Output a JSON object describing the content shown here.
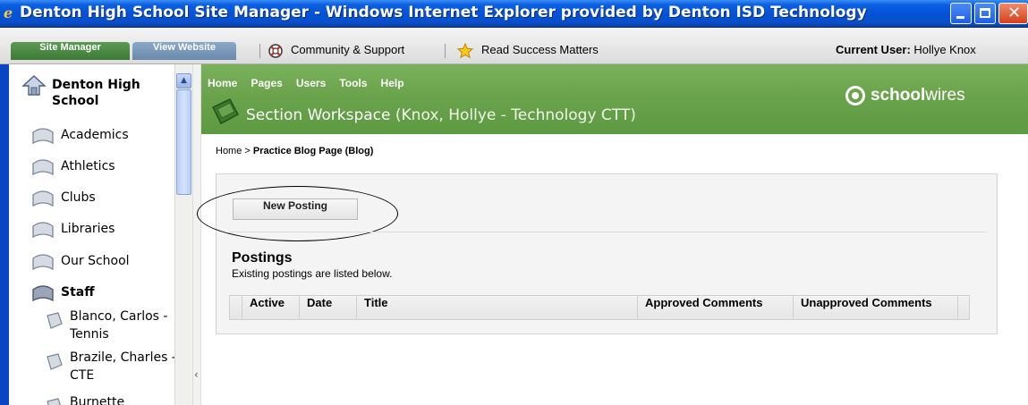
{
  "window": {
    "title": "Denton High School Site Manager - Windows Internet Explorer provided by Denton ISD Technology"
  },
  "toolbar": {
    "tabs": [
      {
        "label": "Site Manager",
        "active": true
      },
      {
        "label": "View Website",
        "active": false
      }
    ],
    "community_link": "Community & Support",
    "read_success_link": "Read Success Matters",
    "current_user_label": "Current User:",
    "current_user_name": "Hollye Knox"
  },
  "sidebar": {
    "root": "Denton High School",
    "items": [
      {
        "label": "Academics"
      },
      {
        "label": "Athletics"
      },
      {
        "label": "Clubs"
      },
      {
        "label": "Libraries"
      },
      {
        "label": "Our School"
      },
      {
        "label": "Staff"
      }
    ],
    "sub_items": [
      {
        "label": "Blanco, Carlos - Tennis"
      },
      {
        "label": "Brazile, Charles - CTE"
      },
      {
        "label": "Burnette"
      }
    ]
  },
  "header": {
    "nav": [
      "Home",
      "Pages",
      "Users",
      "Tools",
      "Help"
    ],
    "workspace_title": "Section Workspace",
    "workspace_owner": "(Knox, Hollye - Technology CTT)",
    "logo_bold": "school",
    "logo_light": "wires"
  },
  "breadcrumb": {
    "home": "Home",
    "separator": ">",
    "current": "Practice Blog Page (Blog)"
  },
  "postings": {
    "new_button": "New Posting",
    "title": "Postings",
    "subtitle": "Existing postings are listed below.",
    "columns": [
      "Active",
      "Date",
      "Title",
      "Approved Comments",
      "Unapproved Comments"
    ]
  },
  "colors": {
    "title_bar": "#0451d6",
    "header_green": "#6aa34c",
    "active_tab": "#4a8a43",
    "inactive_tab": "#7b99bb"
  }
}
